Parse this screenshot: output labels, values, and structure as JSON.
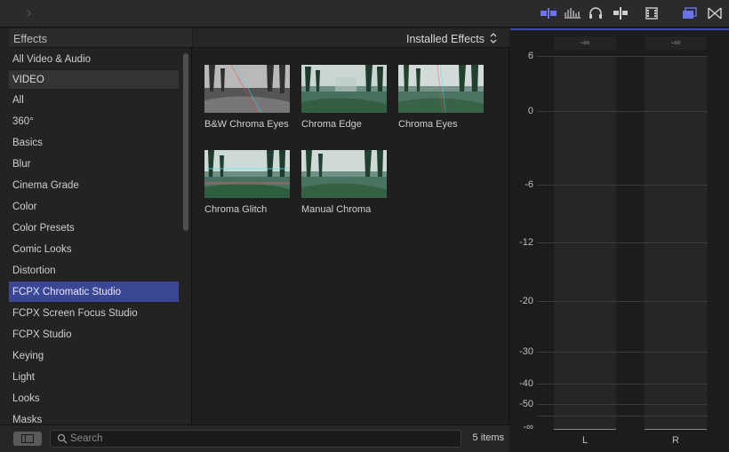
{
  "toolbar": {
    "forward_label": "›"
  },
  "sidebar": {
    "header": "Effects",
    "items": [
      {
        "label": "All Video & Audio",
        "kind": "item"
      },
      {
        "label": "VIDEO",
        "kind": "section"
      },
      {
        "label": "All",
        "kind": "item"
      },
      {
        "label": "360°",
        "kind": "item"
      },
      {
        "label": "Basics",
        "kind": "item"
      },
      {
        "label": "Blur",
        "kind": "item"
      },
      {
        "label": "Cinema Grade",
        "kind": "item"
      },
      {
        "label": "Color",
        "kind": "item"
      },
      {
        "label": "Color Presets",
        "kind": "item"
      },
      {
        "label": "Comic Looks",
        "kind": "item"
      },
      {
        "label": "Distortion",
        "kind": "item"
      },
      {
        "label": "FCPX Chromatic Studio",
        "kind": "selected"
      },
      {
        "label": "FCPX Screen Focus Studio",
        "kind": "item"
      },
      {
        "label": "FCPX Studio",
        "kind": "item"
      },
      {
        "label": "Keying",
        "kind": "item"
      },
      {
        "label": "Light",
        "kind": "item"
      },
      {
        "label": "Looks",
        "kind": "item"
      },
      {
        "label": "Masks",
        "kind": "item"
      }
    ]
  },
  "browser": {
    "title": "Installed Effects",
    "tiles": [
      {
        "label": "B&W Chroma Eyes",
        "style": "bw"
      },
      {
        "label": "Chroma Edge",
        "style": "edge"
      },
      {
        "label": "Chroma Eyes",
        "style": "eyes"
      },
      {
        "label": "Chroma Glitch",
        "style": "glitch"
      },
      {
        "label": "Manual Chroma",
        "style": "manual"
      }
    ],
    "count": "5 items",
    "search_placeholder": "Search"
  },
  "meter": {
    "peak_left": "-∞",
    "peak_right": "-∞",
    "scale": [
      "6",
      "0",
      "-6",
      "-12",
      "-20",
      "-30",
      "-40",
      "-50",
      "-∞"
    ],
    "channels": [
      "L",
      "R"
    ]
  },
  "colors": {
    "selection": "#3a4795",
    "accent": "#6a74e8"
  }
}
